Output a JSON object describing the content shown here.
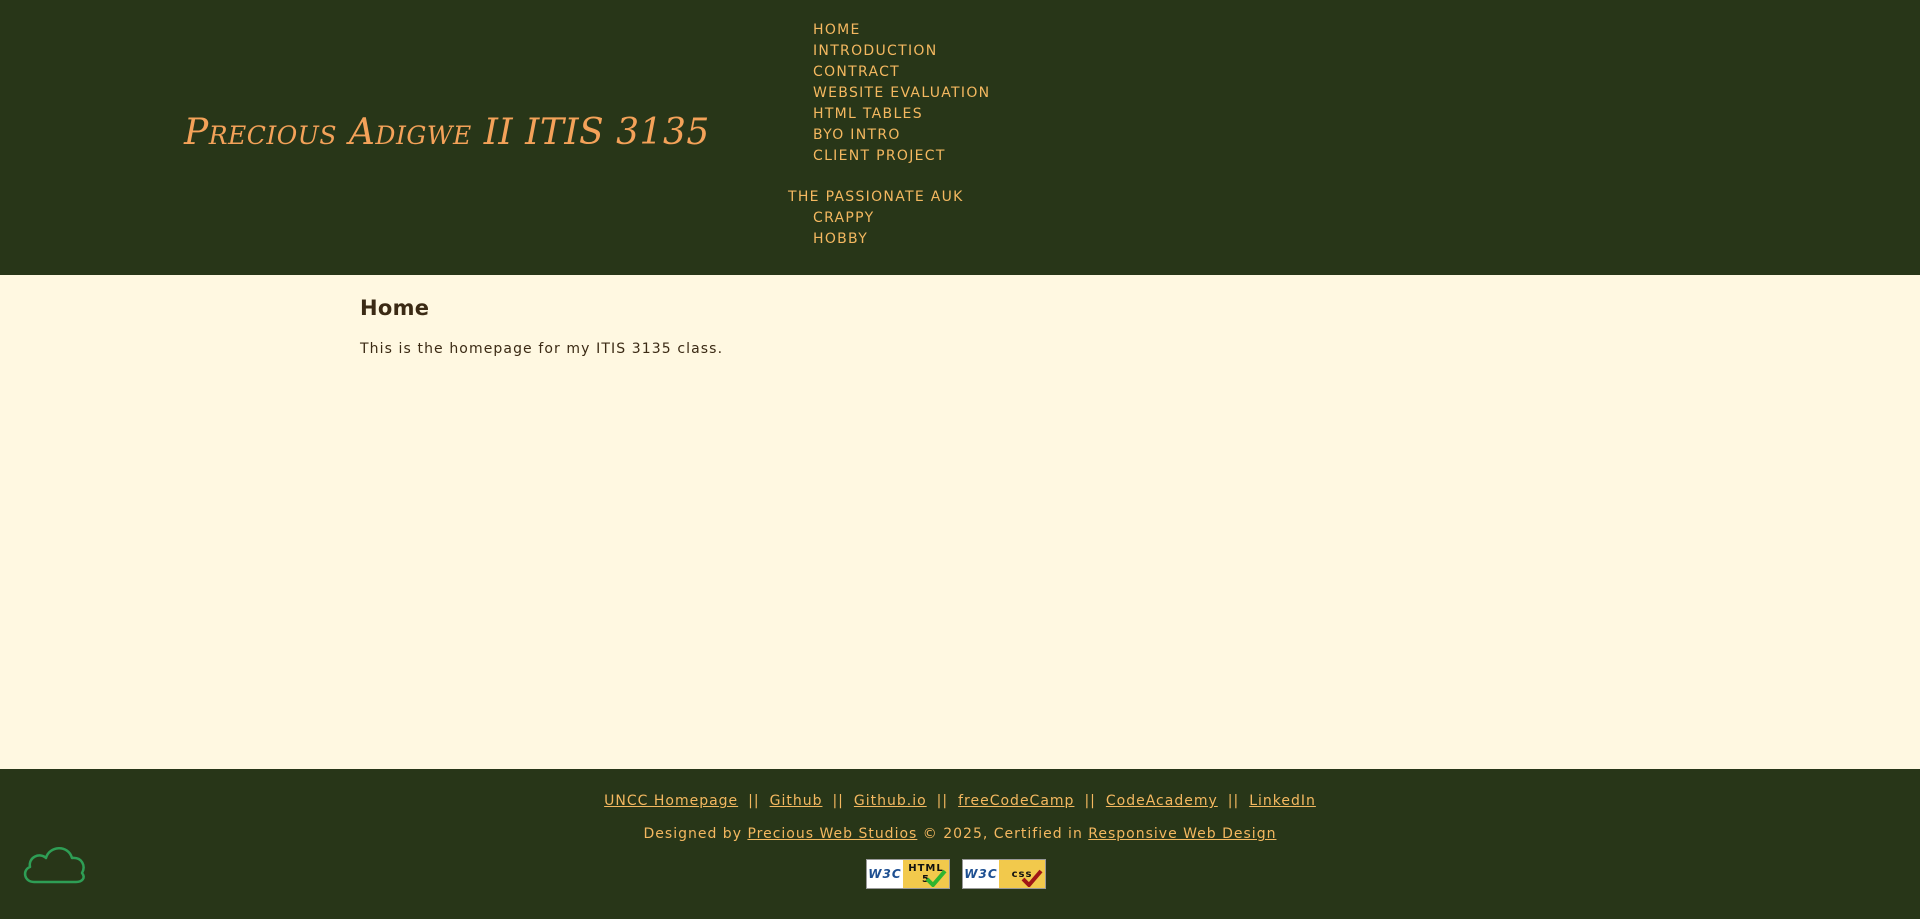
{
  "header": {
    "site_title": "Precious Adigwe II ITIS 3135"
  },
  "nav": {
    "group1": [
      "Home",
      "Introduction",
      "Contract",
      "Website Evaluation",
      "HTML Tables",
      "BYO Intro",
      "Client Project"
    ],
    "group2_title": "The Passionate Auk",
    "group2": [
      "Crappy",
      "Hobby"
    ]
  },
  "main": {
    "title": "Home",
    "intro": "This is the homepage for my ITIS 3135 class."
  },
  "footer": {
    "links": [
      "UNCC Homepage",
      "Github",
      "Github.io",
      "freeCodeCamp",
      "CodeAcademy",
      "LinkedIn"
    ],
    "separator": "||",
    "credit_prefix": "Designed by",
    "credit_link": "Precious Web Studios",
    "credit_middle": "© 2025, Certified in",
    "credit_cert": "Responsive Web Design",
    "badge_html_w3c": "W3C",
    "badge_html_label": "HTML 5",
    "badge_css_w3c": "W3C",
    "badge_css_label": "css"
  },
  "colors": {
    "header_bg": "#283618",
    "accent": "#f4a259",
    "page_bg": "#fff8e1"
  },
  "icons": {
    "cloud": "cloud-icon",
    "check": "check-icon"
  }
}
